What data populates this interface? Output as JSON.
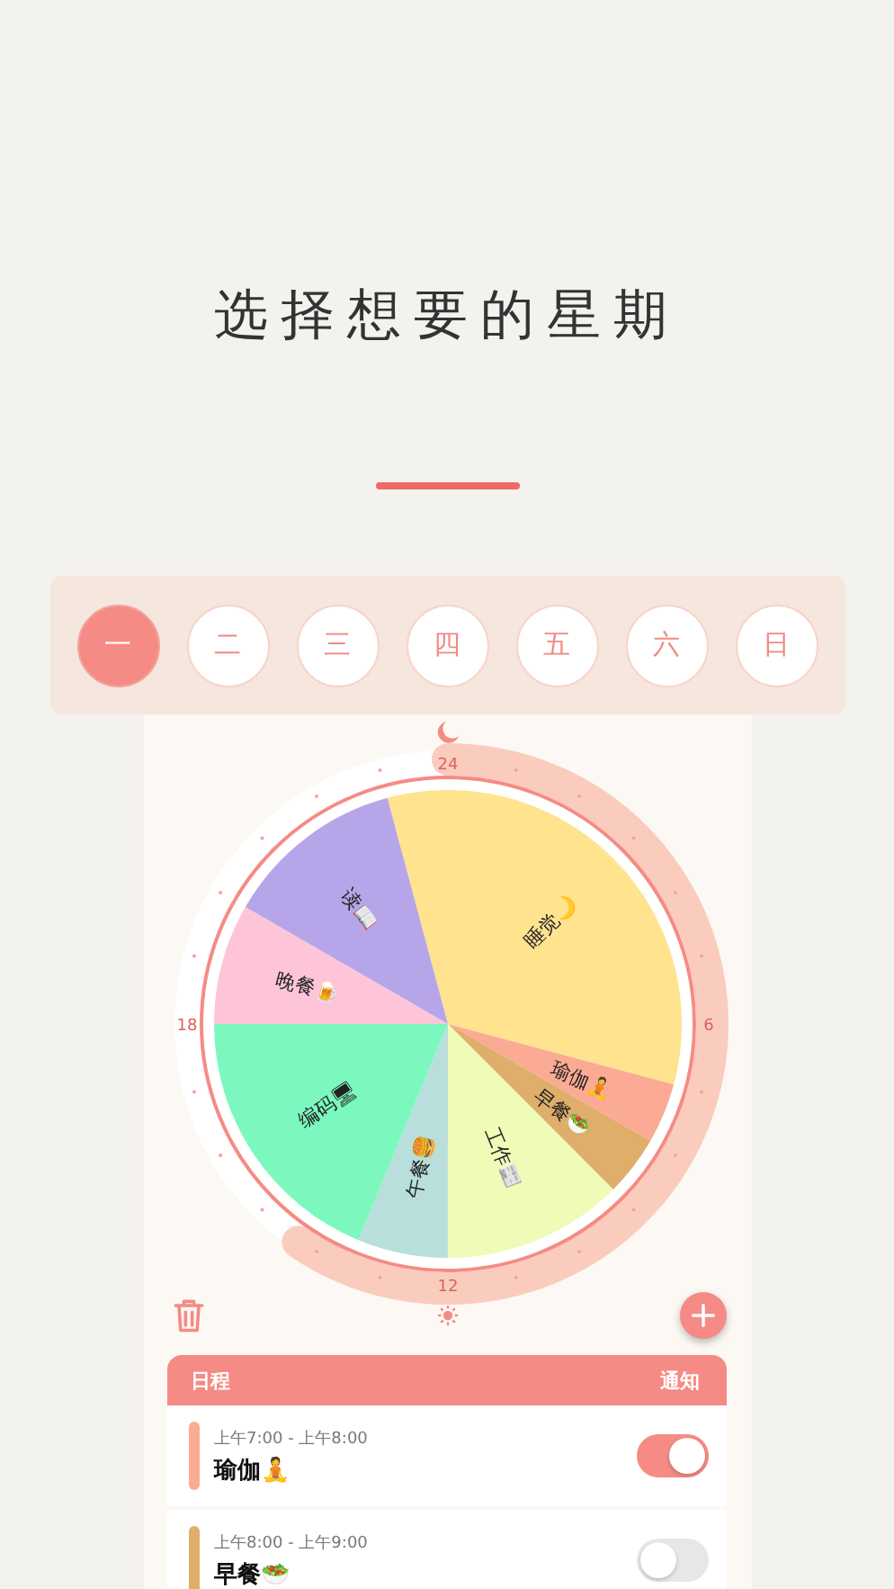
{
  "title": "选择想要的星期",
  "weekdays": [
    {
      "label": "一",
      "selected": true
    },
    {
      "label": "二",
      "selected": false
    },
    {
      "label": "三",
      "selected": false
    },
    {
      "label": "四",
      "selected": false
    },
    {
      "label": "五",
      "selected": false
    },
    {
      "label": "六",
      "selected": false
    },
    {
      "label": "日",
      "selected": false
    }
  ],
  "clock": {
    "dial_labels": [
      "24",
      "6",
      "12",
      "18"
    ],
    "chart_data": {
      "type": "pie",
      "categories": [
        "睡觉🌙",
        "瑜伽🧘",
        "早餐🥗",
        "工作📰",
        "午餐🍔",
        "编码🖥",
        "晚餐🍺",
        "读📖"
      ],
      "values": [
        33.33,
        4.17,
        4.17,
        12.5,
        6.25,
        18.75,
        8.33,
        12.5
      ],
      "colors": [
        "#ffe38f",
        "#fbab93",
        "#dfae6a",
        "#eefcb8",
        "#b8dfdc",
        "#7cf8bf",
        "#fec5d9",
        "#b6a6e9"
      ]
    }
  },
  "schedule": {
    "columns": [
      "日程",
      "通知"
    ],
    "rows": [
      {
        "time": "上午7:00 - 上午8:00",
        "title": "瑜伽🧘",
        "color": "#fbab93",
        "notify": true
      },
      {
        "time": "上午8:00 - 上午9:00",
        "title": "早餐🥗",
        "color": "#dfae6a",
        "notify": false
      }
    ]
  }
}
